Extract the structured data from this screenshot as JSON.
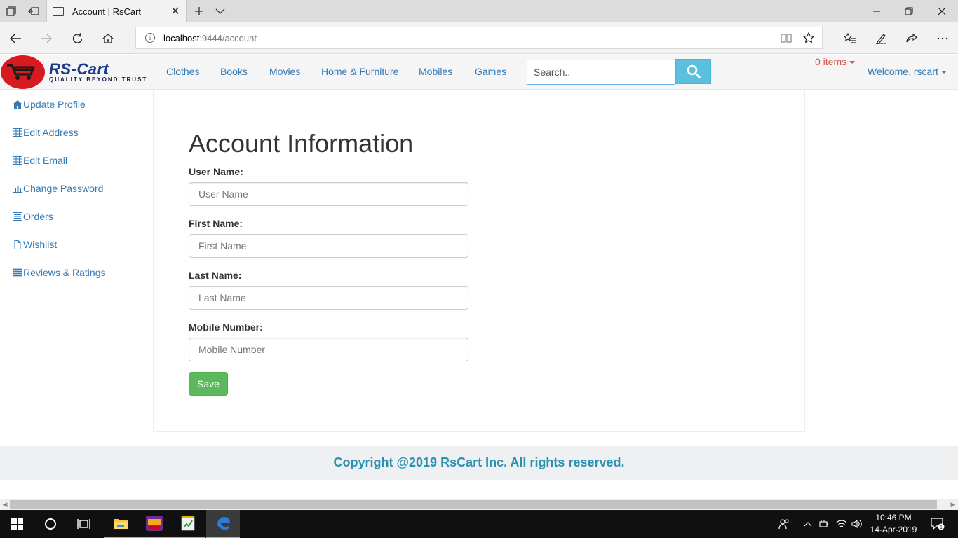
{
  "browser": {
    "tab_title": "Account | RsCart",
    "url_host": "localhost",
    "url_path": ":9444/account"
  },
  "site": {
    "logo_text": "RS-Cart",
    "logo_tagline": "QUALITY BEYOND TRUST",
    "nav": [
      "Clothes",
      "Books",
      "Movies",
      "Home & Furniture",
      "Mobiles",
      "Games"
    ],
    "search_placeholder": "Search..",
    "cart_label": "0 items",
    "welcome_label": "Welcome, rscart"
  },
  "sidebar": {
    "items": [
      {
        "label": "Update Profile",
        "icon": "home-icon"
      },
      {
        "label": "Edit Address",
        "icon": "table-icon"
      },
      {
        "label": "Edit Email",
        "icon": "table-icon"
      },
      {
        "label": "Change Password",
        "icon": "bar-chart-icon"
      },
      {
        "label": "Orders",
        "icon": "list-icon"
      },
      {
        "label": "Wishlist",
        "icon": "file-icon"
      },
      {
        "label": "Reviews & Ratings",
        "icon": "list-icon"
      }
    ]
  },
  "form": {
    "title": "Account Information",
    "fields": [
      {
        "label": "User Name:",
        "placeholder": "User Name",
        "value": ""
      },
      {
        "label": "First Name:",
        "placeholder": "First Name",
        "value": ""
      },
      {
        "label": "Last Name:",
        "placeholder": "Last Name",
        "value": ""
      },
      {
        "label": "Mobile Number:",
        "placeholder": "Mobile Number",
        "value": ""
      }
    ],
    "save_label": "Save"
  },
  "footer": {
    "text": "Copyright @2019 RsCart Inc. All rights reserved."
  },
  "taskbar": {
    "time": "10:46 PM",
    "date": "14-Apr-2019",
    "notification_count": "1"
  },
  "colors": {
    "link": "#337ab7",
    "cart": "#d9534f",
    "save": "#5cb85c",
    "search_button": "#5bc0de",
    "footer_text": "#2a91b3",
    "logo_red": "#d71920"
  }
}
